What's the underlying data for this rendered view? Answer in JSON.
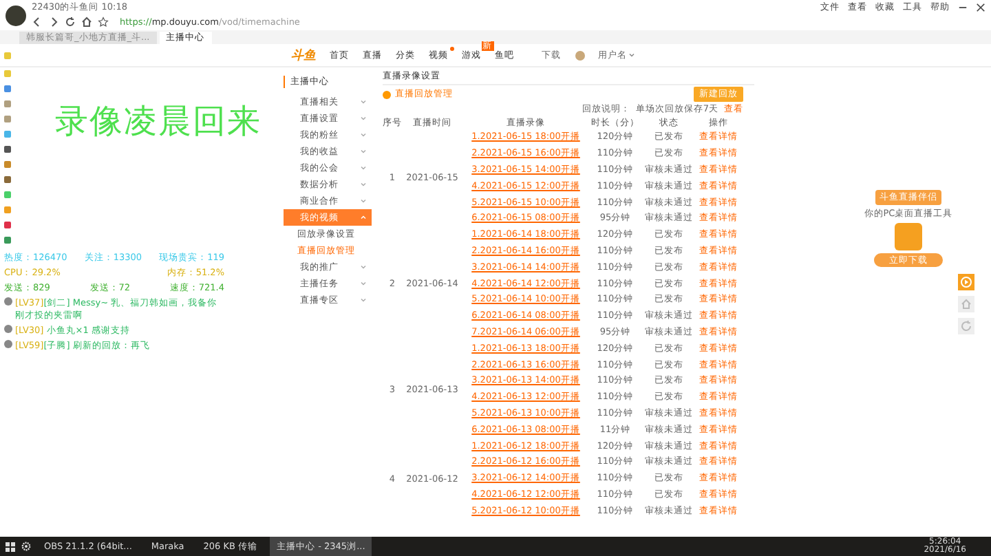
{
  "browser": {
    "window_title": "22430的斗鱼间 10:18",
    "url_secure": "https://",
    "url_host": "mp.douyu.com",
    "url_path": "/vod/timemachine",
    "menu": [
      "文件",
      "查看",
      "收藏",
      "工具",
      "帮助"
    ],
    "tabs": [
      {
        "label": "韩服长篇哥_小地方直播_斗...",
        "selected": false
      },
      {
        "label": "主播中心",
        "selected": true
      }
    ]
  },
  "site_header": {
    "logo": "斗鱼",
    "nav": [
      {
        "label": "首页"
      },
      {
        "label": "直播"
      },
      {
        "label": "分类"
      },
      {
        "label": "视频",
        "dot": true
      },
      {
        "label": "游戏",
        "badge": "新"
      },
      {
        "label": "鱼吧"
      }
    ],
    "download": "下载",
    "username": "用户名"
  },
  "overlay": {
    "banner": "录像凌晨回来",
    "stats": [
      "热度：126470",
      "关注：13300",
      "现场贵宾：119"
    ],
    "cpu": "CPU：29.2%",
    "memory": "内存：51.2%",
    "net": [
      "发送：829",
      "发送：72",
      "速度：721.4"
    ],
    "chat": [
      {
        "level": "[LV37]",
        "badge": "[剑二]",
        "text": "Messy~ 乳、福刀韩如画，我备你刚才投的夹雷啊"
      },
      {
        "level": "[LV30]",
        "text": "小鱼丸×1 感谢支持"
      },
      {
        "level": "[LV59]",
        "badge": "[子腾]",
        "text": "刷新的回放：再飞"
      }
    ]
  },
  "sidebar": {
    "title": "主播中心",
    "items": [
      {
        "label": "直播相关",
        "expanded": false,
        "selected": false
      },
      {
        "label": "直播设置",
        "expanded": false,
        "selected": false
      },
      {
        "label": "我的粉丝",
        "expanded": false,
        "selected": false
      },
      {
        "label": "我的收益",
        "expanded": false,
        "selected": false
      },
      {
        "label": "我的公会",
        "expanded": false,
        "selected": false
      },
      {
        "label": "数据分析",
        "expanded": false,
        "selected": false
      },
      {
        "label": "商业合作",
        "expanded": false,
        "selected": false
      },
      {
        "label": "我的视频",
        "expanded": true,
        "selected": true,
        "children": [
          {
            "label": "回放录像设置",
            "selected": false
          },
          {
            "label": "直播回放管理",
            "selected": true
          }
        ]
      },
      {
        "label": "我的推广",
        "expanded": false,
        "selected": false
      },
      {
        "label": "主播任务",
        "expanded": false,
        "selected": false
      },
      {
        "label": "直播专区",
        "expanded": false,
        "selected": false
      }
    ]
  },
  "content": {
    "title": "直播录像设置",
    "section": "直播回放管理",
    "button": "新建回放",
    "note": "回放说明：",
    "note_detail": "单场次回放保存7天",
    "note_link": "查看",
    "columns": [
      "序号",
      "直播时间",
      "直播录像",
      "时长（分）",
      "状态",
      "操作"
    ],
    "groups": [
      {
        "index": "1",
        "date": "2021-06-15",
        "rows": [
          {
            "title": "1.2021-06-15 18:00开播",
            "duration": "120分钟",
            "status": "已发布",
            "action": "查看详情"
          },
          {
            "title": "2.2021-06-15 16:00开播",
            "duration": "110分钟",
            "status": "已发布",
            "action": "查看详情"
          },
          {
            "title": "3.2021-06-15 14:00开播",
            "duration": "110分钟",
            "status": "审核未通过",
            "action": "查看详情"
          },
          {
            "title": "4.2021-06-15 12:00开播",
            "duration": "110分钟",
            "status": "审核未通过",
            "action": "查看详情"
          },
          {
            "title": "5.2021-06-15 10:00开播",
            "duration": "110分钟",
            "status": "审核未通过",
            "action": "查看详情"
          },
          {
            "title": "6.2021-06-15 08:00开播",
            "duration": "95分钟",
            "status": "审核未通过",
            "action": "查看详情"
          }
        ]
      },
      {
        "index": "2",
        "date": "2021-06-14",
        "rows": [
          {
            "title": "1.2021-06-14 18:00开播",
            "duration": "120分钟",
            "status": "已发布",
            "action": "查看详情"
          },
          {
            "title": "2.2021-06-14 16:00开播",
            "duration": "110分钟",
            "status": "已发布",
            "action": "查看详情"
          },
          {
            "title": "3.2021-06-14 14:00开播",
            "duration": "110分钟",
            "status": "已发布",
            "action": "查看详情"
          },
          {
            "title": "4.2021-06-14 12:00开播",
            "duration": "110分钟",
            "status": "已发布",
            "action": "查看详情"
          },
          {
            "title": "5.2021-06-14 10:00开播",
            "duration": "110分钟",
            "status": "已发布",
            "action": "查看详情"
          },
          {
            "title": "6.2021-06-14 08:00开播",
            "duration": "110分钟",
            "status": "审核未通过",
            "action": "查看详情"
          },
          {
            "title": "7.2021-06-14 06:00开播",
            "duration": "95分钟",
            "status": "审核未通过",
            "action": "查看详情"
          }
        ]
      },
      {
        "index": "3",
        "date": "2021-06-13",
        "rows": [
          {
            "title": "1.2021-06-13 18:00开播",
            "duration": "120分钟",
            "status": "已发布",
            "action": "查看详情"
          },
          {
            "title": "2.2021-06-13 16:00开播",
            "duration": "110分钟",
            "status": "已发布",
            "action": "查看详情"
          },
          {
            "title": "3.2021-06-13 14:00开播",
            "duration": "110分钟",
            "status": "已发布",
            "action": "查看详情"
          },
          {
            "title": "4.2021-06-13 12:00开播",
            "duration": "110分钟",
            "status": "已发布",
            "action": "查看详情"
          },
          {
            "title": "5.2021-06-13 10:00开播",
            "duration": "110分钟",
            "status": "审核未通过",
            "action": "查看详情"
          },
          {
            "title": "6.2021-06-13 08:00开播",
            "duration": "11分钟",
            "status": "审核未通过",
            "action": "查看详情"
          }
        ]
      },
      {
        "index": "4",
        "date": "2021-06-12",
        "rows": [
          {
            "title": "1.2021-06-12 18:00开播",
            "duration": "120分钟",
            "status": "审核未通过",
            "action": "查看详情"
          },
          {
            "title": "2.2021-06-12 16:00开播",
            "duration": "110分钟",
            "status": "审核未通过",
            "action": "查看详情"
          },
          {
            "title": "3.2021-06-12 14:00开播",
            "duration": "110分钟",
            "status": "已发布",
            "action": "查看详情"
          },
          {
            "title": "4.2021-06-12 12:00开播",
            "duration": "110分钟",
            "status": "已发布",
            "action": "查看详情"
          },
          {
            "title": "5.2021-06-12 10:00开播",
            "duration": "110分钟",
            "status": "审核未通过",
            "action": "查看详情"
          }
        ]
      }
    ]
  },
  "promo": {
    "title": "斗鱼直播伴侣",
    "subtitle": "你的PC桌面直播工具",
    "button": "立即下载"
  },
  "taskbar": {
    "apps": [
      {
        "label": "OBS 21.1.2 (64bit...",
        "selected": false
      },
      {
        "label": "Maraka",
        "selected": false
      },
      {
        "label": "206 KB 传输",
        "selected": false
      },
      {
        "label": "主播中心 - 2345浏...",
        "selected": true
      }
    ],
    "time": "5:26:04",
    "date": "2021/6/16"
  }
}
